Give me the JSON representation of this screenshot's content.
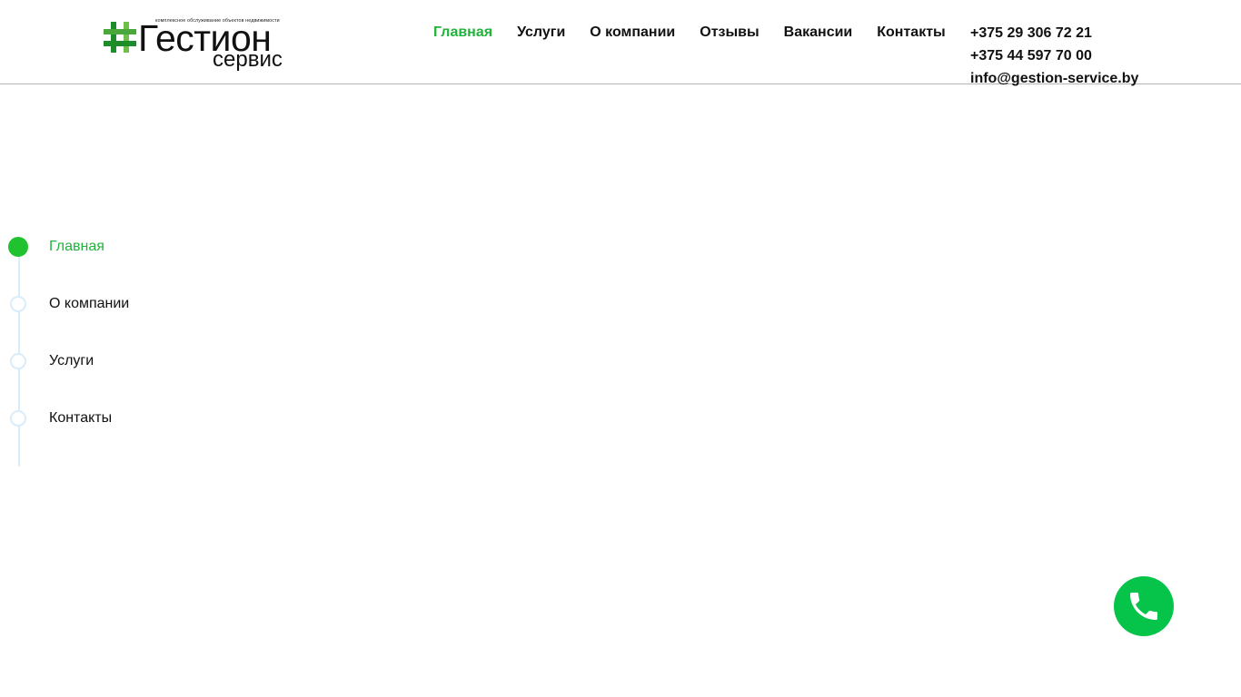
{
  "header": {
    "logo": {
      "tagline": "комплексное обслуживание объектов недвижимости",
      "name": "Гестион",
      "sub": "сервис"
    },
    "nav": [
      {
        "label": "Главная",
        "active": true
      },
      {
        "label": "Услуги",
        "active": false
      },
      {
        "label": "О компании",
        "active": false
      },
      {
        "label": "Отзывы",
        "active": false
      },
      {
        "label": "Вакансии",
        "active": false
      },
      {
        "label": "Контакты",
        "active": false
      }
    ],
    "contacts": {
      "phone1": "+375 29 306 72 21",
      "phone2": "+375 44 597 70 00",
      "email": "info@gestion-service.by"
    }
  },
  "side_nav": {
    "items": [
      {
        "label": "Главная",
        "active": true
      },
      {
        "label": "О компании",
        "active": false
      },
      {
        "label": "Услуги",
        "active": false
      },
      {
        "label": "Контакты",
        "active": false
      }
    ]
  },
  "call_button": {
    "icon": "phone-icon"
  },
  "colors": {
    "accent": "#21b33b",
    "call_button": "#06c449",
    "side_line": "#d8ecfa"
  }
}
